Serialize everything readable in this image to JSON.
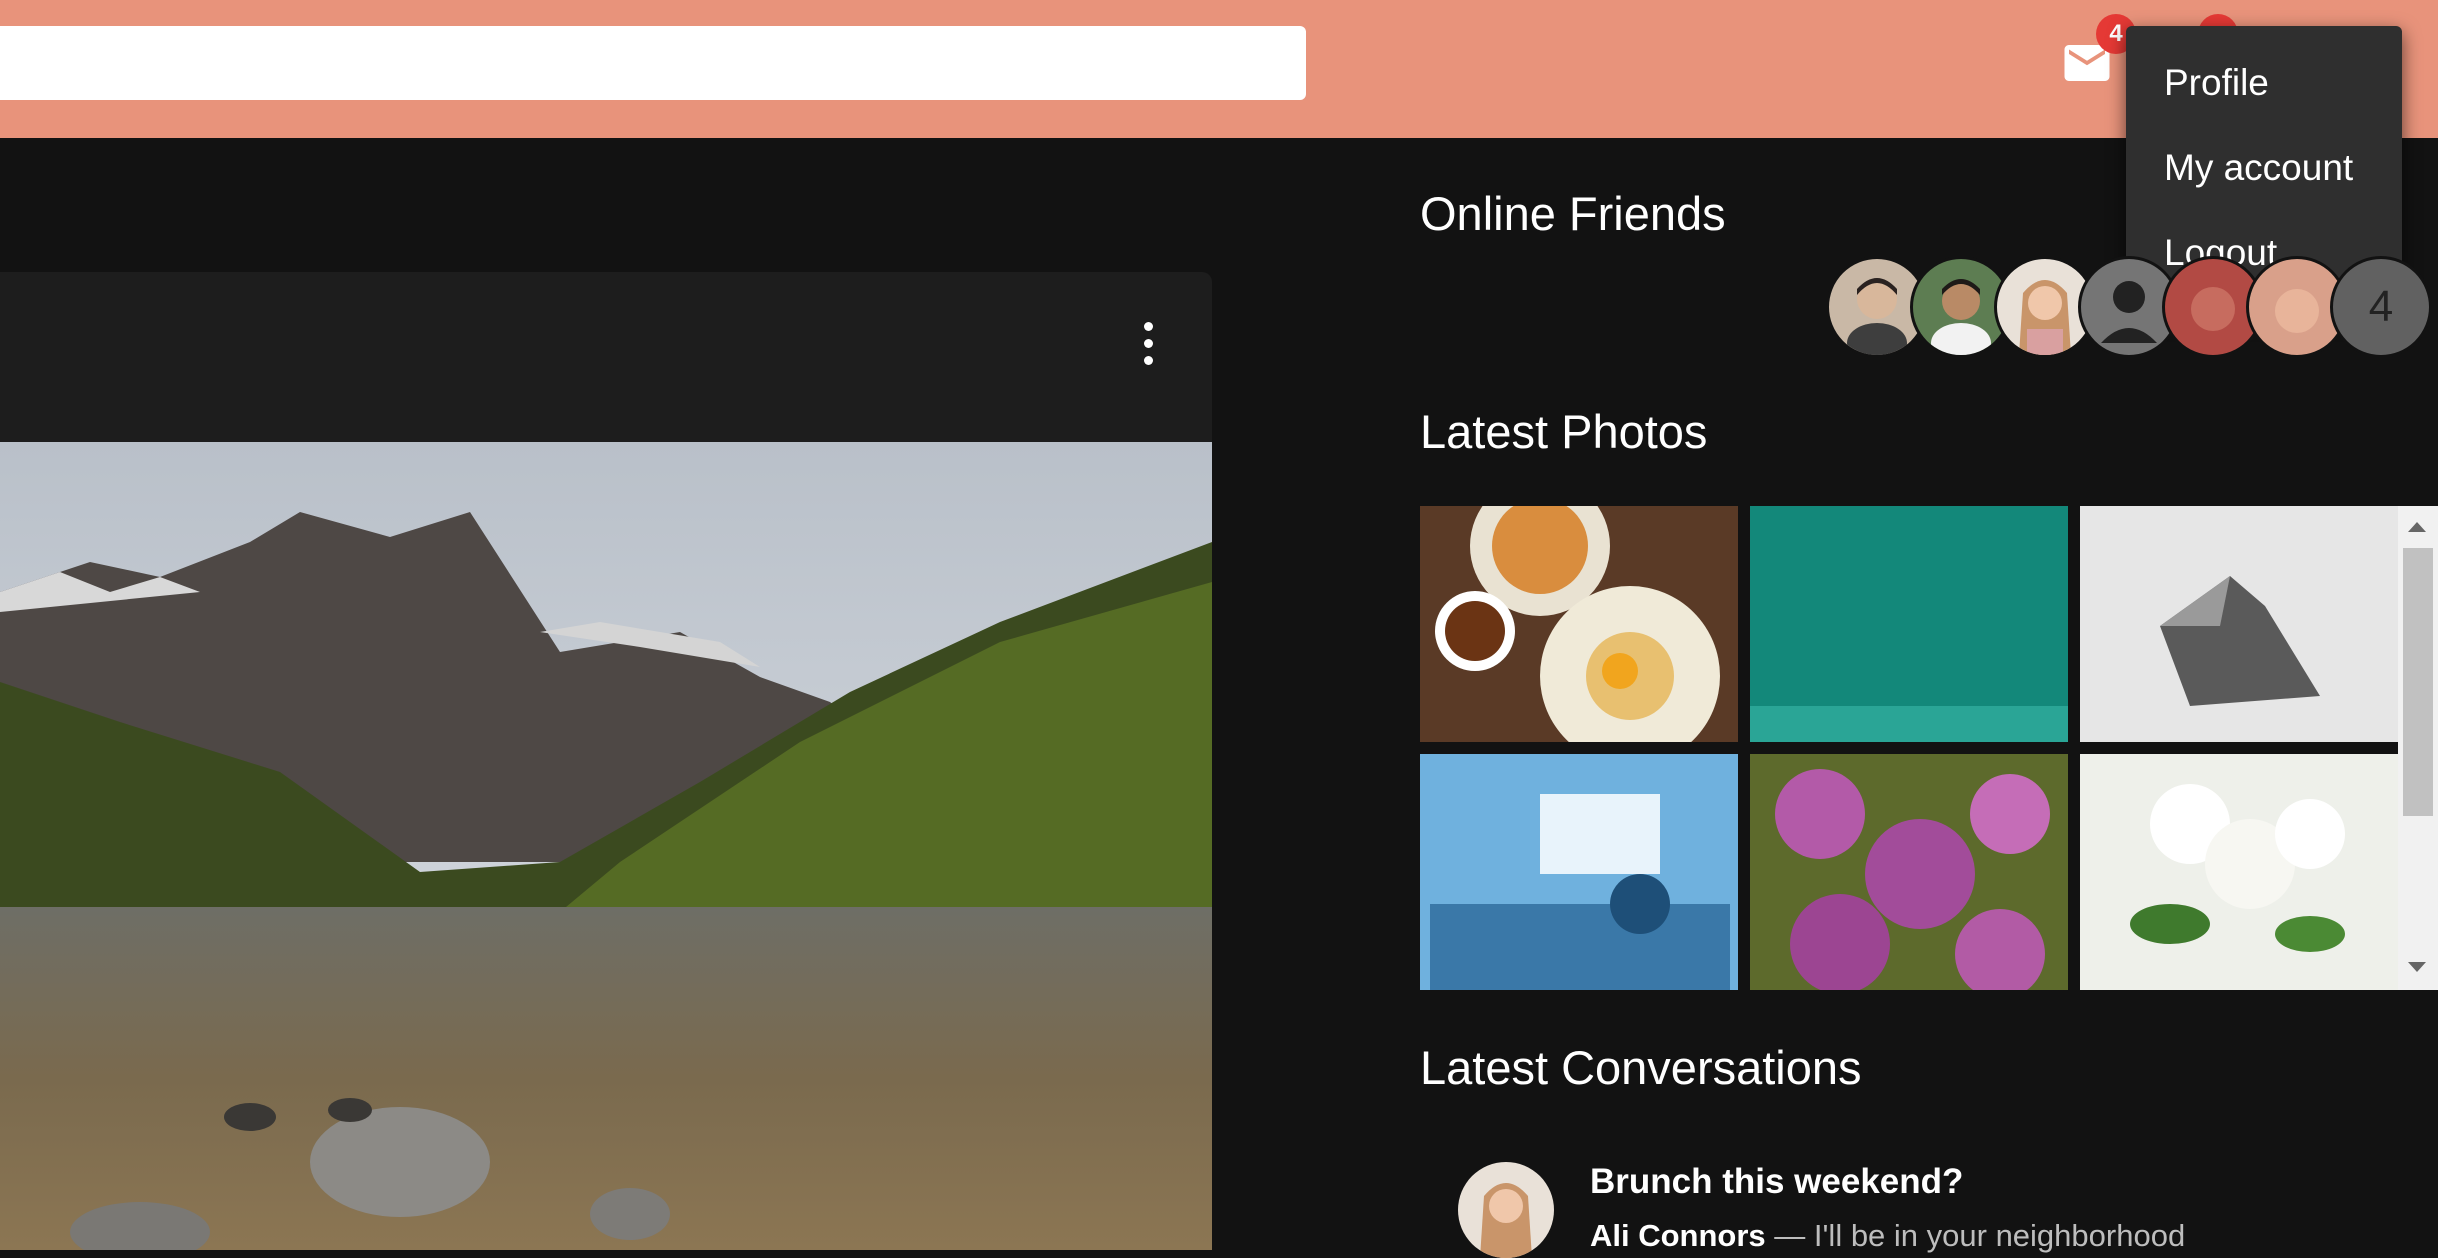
{
  "header": {
    "mail_badge": "4",
    "notification_badge": "",
    "accent_color": "#e8937b"
  },
  "account_menu": {
    "items": [
      {
        "label": "Profile"
      },
      {
        "label": "My account"
      },
      {
        "label": "Logout"
      }
    ]
  },
  "sidebar": {
    "online_friends_title": "Online Friends",
    "overflow_count": "4",
    "latest_photos_title": "Latest Photos",
    "latest_conversations_title": "Latest Conversations",
    "conversation": {
      "title": "Brunch this weekend?",
      "author": "Ali Connors",
      "preview": " — I'll be in your neighborhood"
    }
  },
  "icons": [
    "mail-icon",
    "more-vert-icon",
    "person-icon"
  ]
}
